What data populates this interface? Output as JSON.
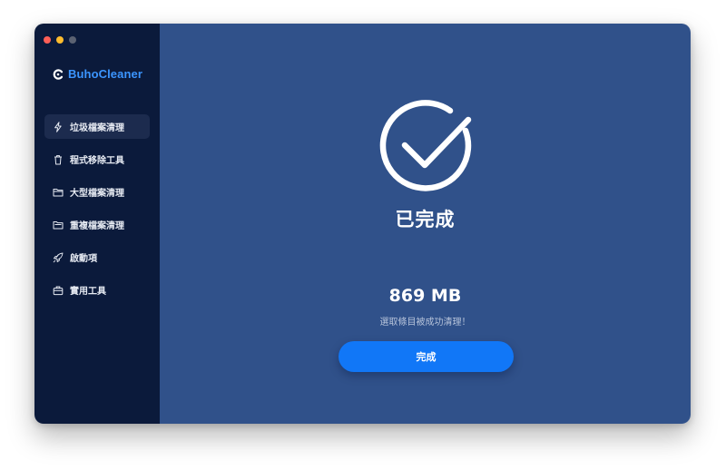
{
  "app": {
    "brand_name": "BuhoCleaner",
    "accent_color": "#3b95ff",
    "sidebar_color": "#0b1a3b",
    "main_color": "#30518a"
  },
  "sidebar": {
    "items": [
      {
        "label": "垃圾檔案清理",
        "icon": "lightning-icon",
        "active": true
      },
      {
        "label": "程式移除工具",
        "icon": "trash-icon",
        "active": false
      },
      {
        "label": "大型檔案清理",
        "icon": "folder-icon",
        "active": false
      },
      {
        "label": "重複檔案清理",
        "icon": "duplicate-folder-icon",
        "active": false
      },
      {
        "label": "啟動項",
        "icon": "rocket-icon",
        "active": false
      },
      {
        "label": "實用工具",
        "icon": "toolbox-icon",
        "active": false
      }
    ]
  },
  "main": {
    "status_icon": "check-circle-icon",
    "status_title": "已完成",
    "size_value": "869 MB",
    "size_caption": "選取條目被成功清理！",
    "done_button": {
      "label": "完成",
      "color": "#1177f7"
    }
  }
}
